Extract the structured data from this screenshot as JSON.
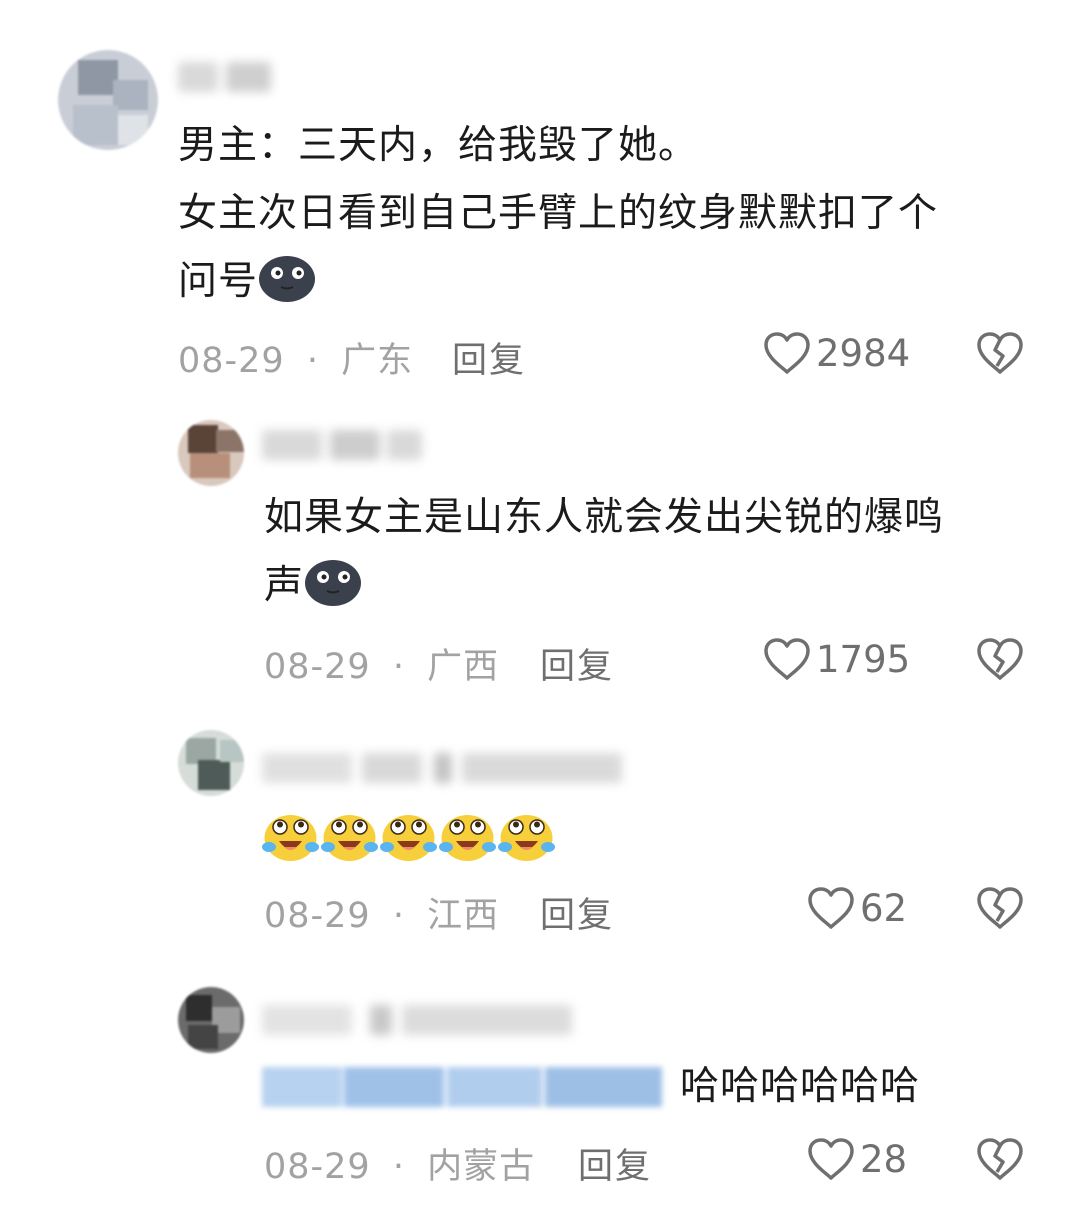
{
  "comments": [
    {
      "text_line1": "男主：三天内，给我毁了她。",
      "text_line2": "女主次日看到自己手臂上的纹身默默扣了个",
      "text_line3": "问号",
      "emoji": "dark-moon-face-emoji",
      "date": "08-29",
      "location": "广东",
      "reply_label": "回复",
      "likes": "2984"
    },
    {
      "text_line1": "如果女主是山东人就会发出尖锐的爆鸣",
      "text_line2": "声",
      "emoji": "dark-moon-face-emoji",
      "date": "08-29",
      "location": "广西",
      "reply_label": "回复",
      "likes": "1795"
    },
    {
      "emoji": "crying-laughing-emoji",
      "emoji_count": 5,
      "date": "08-29",
      "location": "江西",
      "reply_label": "回复",
      "likes": "62"
    },
    {
      "text": "哈哈哈哈哈哈",
      "date": "08-29",
      "location": "内蒙古",
      "reply_label": "回复",
      "likes": "28"
    }
  ],
  "meta_separator": "·",
  "icons": {
    "like": "heart-outline-icon",
    "dislike": "broken-heart-icon"
  },
  "colors": {
    "body_text": "#1b1b1b",
    "meta_text": "#a2a2a2",
    "action_text": "#6f6f6f",
    "mention_blur": "#a9c9ec"
  }
}
